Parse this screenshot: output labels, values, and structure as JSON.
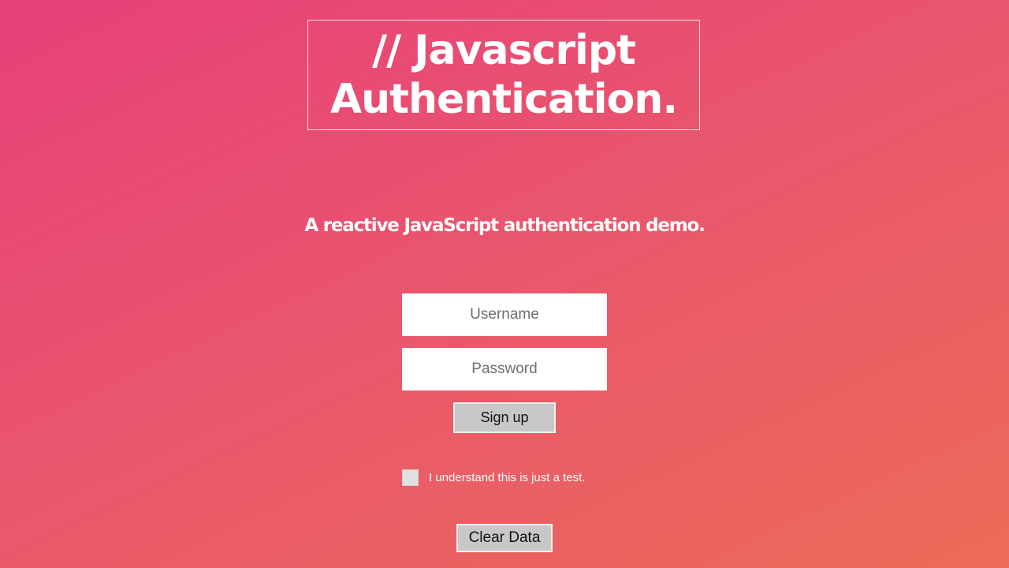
{
  "header": {
    "title_line1": "// Javascript",
    "title_line2": "Authentication."
  },
  "subtitle": "A reactive JavaScript authentication demo.",
  "form": {
    "username_placeholder": "Username",
    "password_placeholder": "Password",
    "signup_label": "Sign up",
    "consent_label": "I understand this is just a test.",
    "consent_checked": false
  },
  "clear_button_label": "Clear Data",
  "colors": {
    "gradient_start": "#e84079",
    "gradient_end": "#ec6b58",
    "button_bg": "#c8c8c8"
  }
}
